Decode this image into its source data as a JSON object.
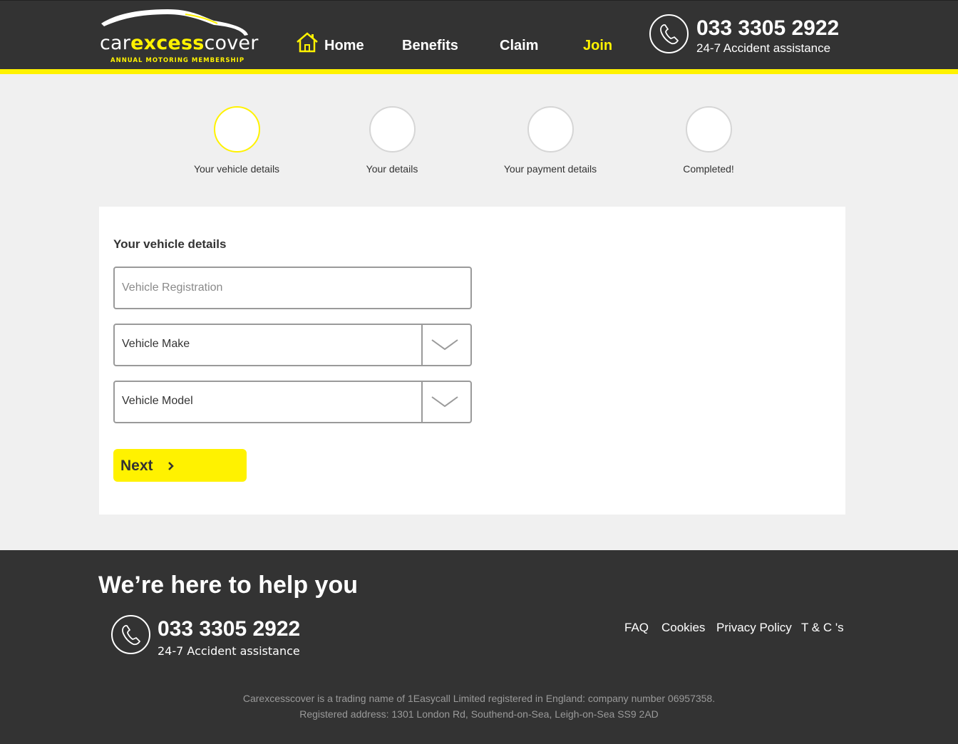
{
  "brand": {
    "name_light_1": "car",
    "name_bold": "excess",
    "name_light_2": "cover",
    "tagline": "ANNUAL MOTORING MEMBERSHIP",
    "accent_color": "#fff200",
    "dark_color": "#333333"
  },
  "nav": {
    "home": "Home",
    "benefits": "Benefits",
    "claim": "Claim",
    "join": "Join"
  },
  "header_contact": {
    "phone": "033 3305 2922",
    "subtitle": "24-7 Accident assistance",
    "icon": "phone-icon"
  },
  "steps": [
    {
      "label": "Your vehicle details",
      "state": "current"
    },
    {
      "label": "Your details",
      "state": "upcoming"
    },
    {
      "label": "Your payment details",
      "state": "upcoming"
    },
    {
      "label": "Completed!",
      "state": "upcoming"
    }
  ],
  "form": {
    "heading": "Your vehicle details",
    "registration": {
      "placeholder": "Vehicle Registration",
      "value": ""
    },
    "make": {
      "selected": "Vehicle Make"
    },
    "model": {
      "selected": "Vehicle Model"
    },
    "next_label": "Next"
  },
  "footer": {
    "heading": "We’re here to help you",
    "phone": "033 3305 2922",
    "subtitle": "24-7 Accident assistance",
    "links": {
      "faq": "FAQ",
      "cookies": "Cookies",
      "privacy": "Privacy Policy",
      "terms": "T & C 's"
    },
    "legal_line_1": "Carexcesscover is a trading name of 1Easycall Limited registered in England: company number 06957358.",
    "legal_line_2": "Registered address: 1301 London Rd, Southend-on-Sea, Leigh-on-Sea SS9 2AD"
  }
}
